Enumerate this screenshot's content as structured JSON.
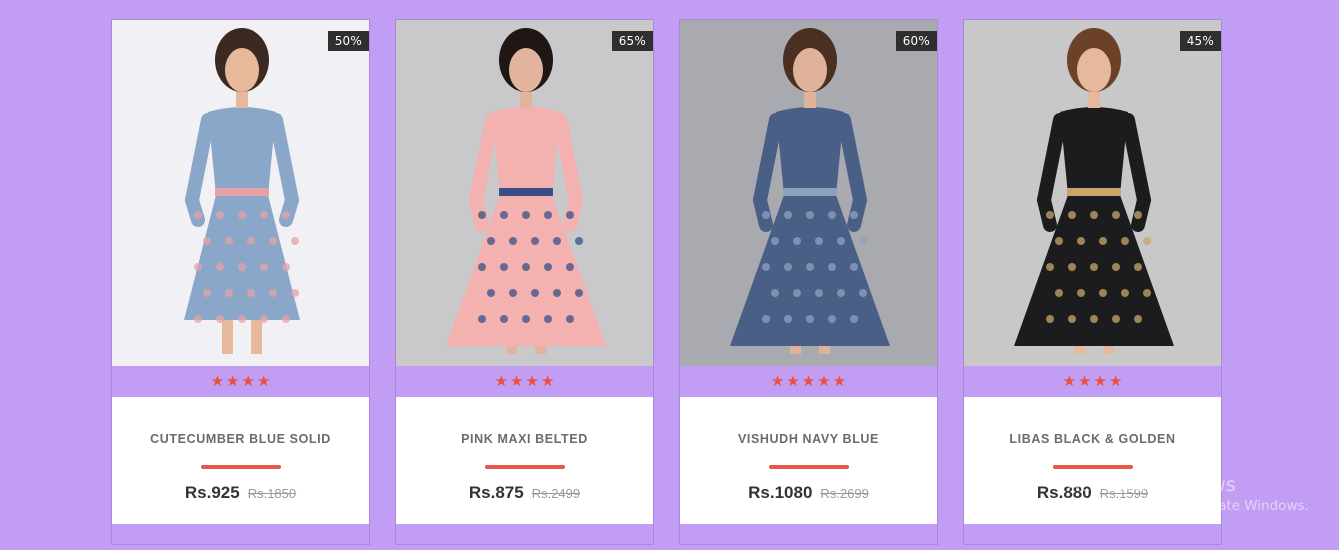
{
  "products": [
    {
      "name": "CUTECUMBER BLUE SOLID",
      "discount": "50%",
      "price": "Rs.925",
      "old_price": "Rs.1850",
      "rating": 4,
      "image_bg": "#f1f0f4",
      "outfit_color": "#8aa6c9",
      "outfit_secondary": "#e5a1a4",
      "skin_color": "#e8b89a",
      "hair_color": "#3b2a22"
    },
    {
      "name": "PINK MAXI BELTED",
      "discount": "65%",
      "price": "Rs.875",
      "old_price": "Rs.2499",
      "rating": 4,
      "image_bg": "#c9c9cc",
      "outfit_color": "#f3b2b0",
      "outfit_secondary": "#3a4f86",
      "skin_color": "#e2b39d",
      "hair_color": "#1e1714"
    },
    {
      "name": "VISHUDH NAVY BLUE",
      "discount": "60%",
      "price": "Rs.1080",
      "old_price": "Rs.2699",
      "rating": 5,
      "image_bg": "#a9aab0",
      "outfit_color": "#4a5f86",
      "outfit_secondary": "#8fa0bf",
      "skin_color": "#e0b29a",
      "hair_color": "#4a2f22"
    },
    {
      "name": "LIBAS BLACK & GOLDEN",
      "discount": "45%",
      "price": "Rs.880",
      "old_price": "Rs.1599",
      "rating": 4,
      "image_bg": "#c8c8c9",
      "outfit_color": "#1c1c1f",
      "outfit_secondary": "#caa56a",
      "skin_color": "#e6b89c",
      "hair_color": "#6b4128"
    }
  ],
  "watermark": {
    "line1": "Activate Windows",
    "line2": "Go to Settings to activate Windows."
  },
  "colors": {
    "page_bg": "#c29df4",
    "star": "#ea4f42",
    "accent_bar": "#e8574a",
    "badge_bg": "#2f2f2f"
  },
  "icons": {
    "rating": "star-icon"
  }
}
